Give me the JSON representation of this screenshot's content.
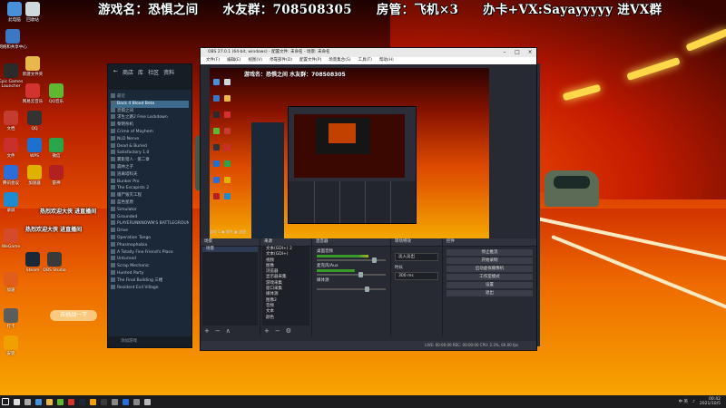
{
  "banner": {
    "game": "游戏名：恐惧之间",
    "fan_group": "水友群：708508305",
    "room_manager": "房管：飞机×3",
    "card": "办卡+VX:Sayayyyyy 进VX群"
  },
  "desktop_icons": [
    {
      "label": "此电脑",
      "color": "#4a90d9"
    },
    {
      "label": "回收站",
      "color": "#cfd8dc"
    },
    {
      "label": "网络和共享中心",
      "color": "#3b78c4"
    },
    {
      "label": "新建文件夹",
      "color": "#e8b84a"
    },
    {
      "label": "Epic Games Launcher",
      "color": "#2b2b2b"
    },
    {
      "label": "网易云音乐",
      "color": "#d3332e"
    },
    {
      "label": "QQ音乐",
      "color": "#5fb830"
    },
    {
      "label": "文档",
      "color": "#c43b2f"
    },
    {
      "label": "QQ",
      "color": "#333333"
    },
    {
      "label": "文件",
      "color": "#c9302c"
    },
    {
      "label": "WPS",
      "color": "#1f6fd1"
    },
    {
      "label": "微信",
      "color": "#2aa64a"
    },
    {
      "label": "腾讯会议",
      "color": "#2c6dd8"
    },
    {
      "label": "加速器",
      "color": "#e0b100"
    },
    {
      "label": "雷神",
      "color": "#b32020"
    },
    {
      "label": "录屏",
      "color": "#1d8bd1"
    },
    {
      "label": "WeGame",
      "color": "#d44a2a"
    },
    {
      "label": "Steam",
      "color": "#1b2838"
    },
    {
      "label": "OBS Studio",
      "color": "#3a3a3a"
    },
    {
      "label": "加速",
      "color": "#e05e18"
    },
    {
      "label": "打卡",
      "color": "#5c5c5c"
    },
    {
      "label": "安装",
      "color": "#f0a000"
    }
  ],
  "chat": {
    "line1": "热烈欢迎大侠 进直播间",
    "line2": "热烈欢迎大侠 进直播间",
    "bubble": "去挑战一下"
  },
  "steam": {
    "nav": [
      "商店",
      "库",
      "社区",
      "资料"
    ],
    "section_recent": "最近",
    "games": [
      "Back 4 Blood Beta",
      "恐惧之间",
      "求生之路2 Free Lockdown",
      "黎明杀机",
      "Crime of Mayhem",
      "NLD Nerve",
      "Dead & Buried",
      "Satisfactory 1.0",
      "雾影猎人 · 第二章",
      "森林之子",
      "逃离塔科夫",
      "Bunker Pro",
      "The Escapists 2",
      "僵尸毁灭工程",
      "蓝色星原",
      "Simulator",
      "Grounded",
      "PLAYERUNKNOWN'S BATTLEGROUNDS",
      "Drive",
      "Operation Tango",
      "Phasmophobia",
      "A Totally Fine Friend's Place",
      "Unturned",
      "Scrap Mechanic",
      "Hunted Party",
      "The Final Building 三楼",
      "Resident Evil Village"
    ],
    "selected_index": 0,
    "footer": "添加游戏"
  },
  "obs": {
    "title": "OBS 27.0.1 (64-bit, windows) - 配置文件: 未命名 - 场景: 未命名",
    "menu": [
      "文件(F)",
      "编辑(E)",
      "视图(V)",
      "停靠部件(D)",
      "配置文件(P)",
      "场景集合(S)",
      "工具(T)",
      "帮助(H)"
    ],
    "status_row": "游戏 1 ● 属性 ● 滤镜",
    "docks": {
      "scenes": {
        "title": "场景",
        "items": [
          "场景"
        ]
      },
      "sources": {
        "title": "来源",
        "items": [
          "文本(GDI+) 2",
          "文本(GDI+)",
          "视频",
          "图像",
          "浏览器",
          "显示器采集",
          "游戏采集",
          "窗口采集",
          "媒体源",
          "图像2",
          "音频",
          "文本",
          "颜色"
        ]
      },
      "mixer": {
        "title": "混音器",
        "channels": [
          {
            "name": "桌面音频",
            "level": 0.75,
            "volume": 0.8
          },
          {
            "name": "麦克风/Aux",
            "level": 0.55,
            "volume": 0.6
          },
          {
            "name": "媒体源",
            "level": 0.0,
            "volume": 0.7
          }
        ]
      },
      "transitions": {
        "title": "转场特效",
        "type": "淡入淡出",
        "duration_label": "时长",
        "duration": "300 ms"
      },
      "controls": {
        "title": "控件",
        "buttons": [
          "停止推流",
          "开始录制",
          "启动虚拟摄像机",
          "工作室模式",
          "设置",
          "退出"
        ]
      }
    },
    "statusbar": "LIVE: 00:00:00  REC: 00:00:00  CPU: 2.3%, 60.00 fps"
  },
  "taskbar": {
    "time": "00:42",
    "date": "2021/10/5",
    "tray_text": "中 英"
  }
}
